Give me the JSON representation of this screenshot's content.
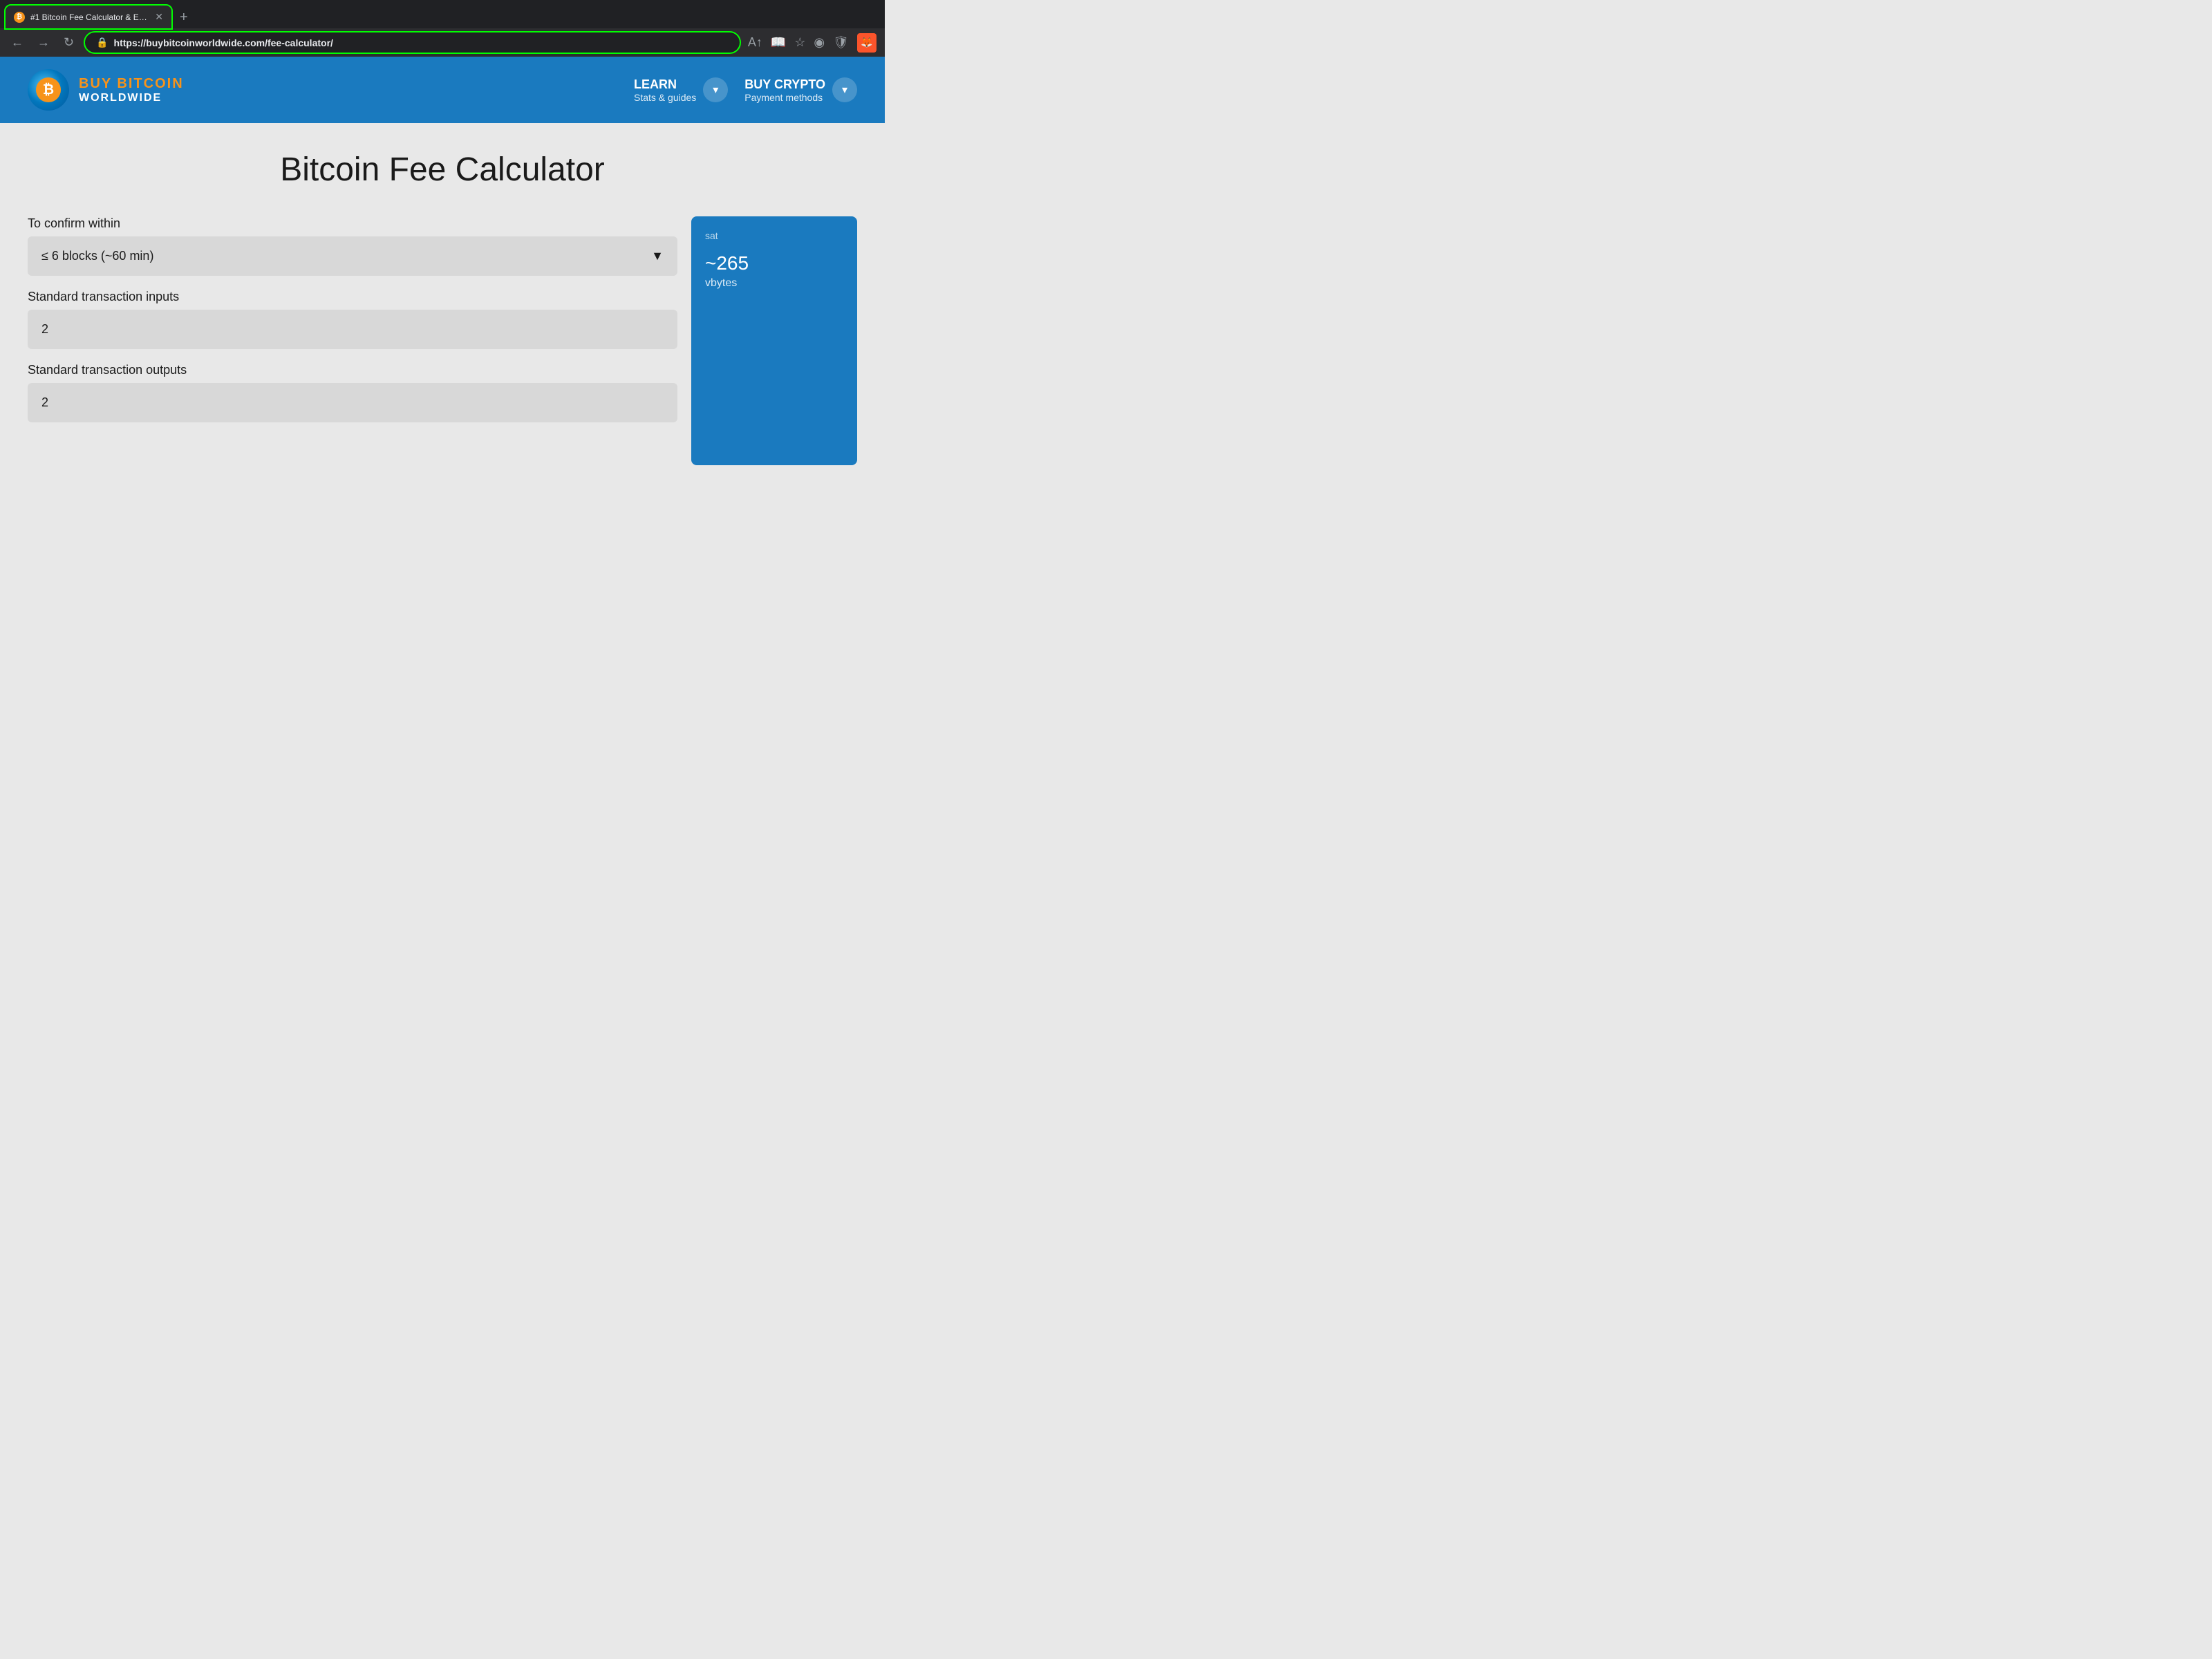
{
  "browser": {
    "tab": {
      "favicon": "₿",
      "title": "#1 Bitcoin Fee Calculator & Estin",
      "active": true
    },
    "new_tab_label": "+",
    "nav": {
      "back_label": "←",
      "forward_label": "→",
      "reload_label": "↻"
    },
    "address": {
      "protocol": "https://",
      "domain": "buybitcoinworldwide.com",
      "path": "/fee-calculator/"
    },
    "icons": {
      "font_label": "A",
      "reader_label": "☰",
      "bookmark_label": "☆",
      "profile_label": "◉",
      "shield_label": "🛡",
      "brave_label": "🦊"
    }
  },
  "site": {
    "logo": {
      "btc_symbol": "₿",
      "line1": "BUY BITCOIN",
      "line2": "WORLDWIDE"
    },
    "nav": {
      "learn": {
        "main": "LEARN",
        "sub": "Stats & guides",
        "dropdown_label": "▾"
      },
      "buy_crypto": {
        "main": "BUY CRYPTO",
        "sub": "Payment methods",
        "dropdown_label": "▾"
      }
    }
  },
  "page": {
    "title": "Bitcoin Fee Calculator",
    "form": {
      "confirm_label": "To confirm within",
      "confirm_value": "≤ 6 blocks (~60 min)",
      "inputs_label": "Standard transaction inputs",
      "inputs_value": "2",
      "outputs_label": "Standard transaction outputs",
      "outputs_value": "2"
    },
    "result": {
      "unit_label": "sat",
      "vbytes_value": "~265",
      "vbytes_unit": "vbytes"
    }
  }
}
